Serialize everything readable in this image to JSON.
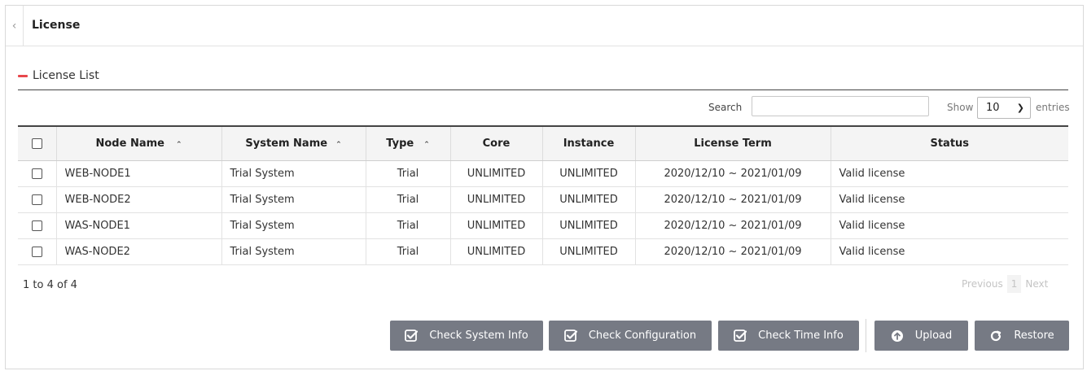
{
  "header": {
    "title": "License",
    "collapse_icon": "chevron-left-icon"
  },
  "section": {
    "title": "License List"
  },
  "search": {
    "label": "Search",
    "value": "",
    "placeholder": ""
  },
  "length": {
    "show_label": "Show",
    "value": "10",
    "entries_label": "entries"
  },
  "table": {
    "columns": [
      "Node Name",
      "System Name",
      "Type",
      "Core",
      "Instance",
      "License Term",
      "Status"
    ],
    "sortable": [
      "Node Name",
      "System Name",
      "Type"
    ],
    "rows": [
      {
        "node": "WEB-NODE1",
        "system": "Trial System",
        "type": "Trial",
        "core": "UNLIMITED",
        "instance": "UNLIMITED",
        "term": "2020/12/10 ~ 2021/01/09",
        "status": "Valid license"
      },
      {
        "node": "WEB-NODE2",
        "system": "Trial System",
        "type": "Trial",
        "core": "UNLIMITED",
        "instance": "UNLIMITED",
        "term": "2020/12/10 ~ 2021/01/09",
        "status": "Valid license"
      },
      {
        "node": "WAS-NODE1",
        "system": "Trial System",
        "type": "Trial",
        "core": "UNLIMITED",
        "instance": "UNLIMITED",
        "term": "2020/12/10 ~ 2021/01/09",
        "status": "Valid license"
      },
      {
        "node": "WAS-NODE2",
        "system": "Trial System",
        "type": "Trial",
        "core": "UNLIMITED",
        "instance": "UNLIMITED",
        "term": "2020/12/10 ~ 2021/01/09",
        "status": "Valid license"
      }
    ]
  },
  "info": "1 to 4 of 4",
  "pagination": {
    "previous": "Previous",
    "page": "1",
    "next": "Next"
  },
  "buttons": {
    "check_system": "Check System Info",
    "check_config": "Check Configuration",
    "check_time": "Check Time Info",
    "upload": "Upload",
    "restore": "Restore"
  },
  "colors": {
    "accent": "#e8474c",
    "button": "#767a84"
  }
}
